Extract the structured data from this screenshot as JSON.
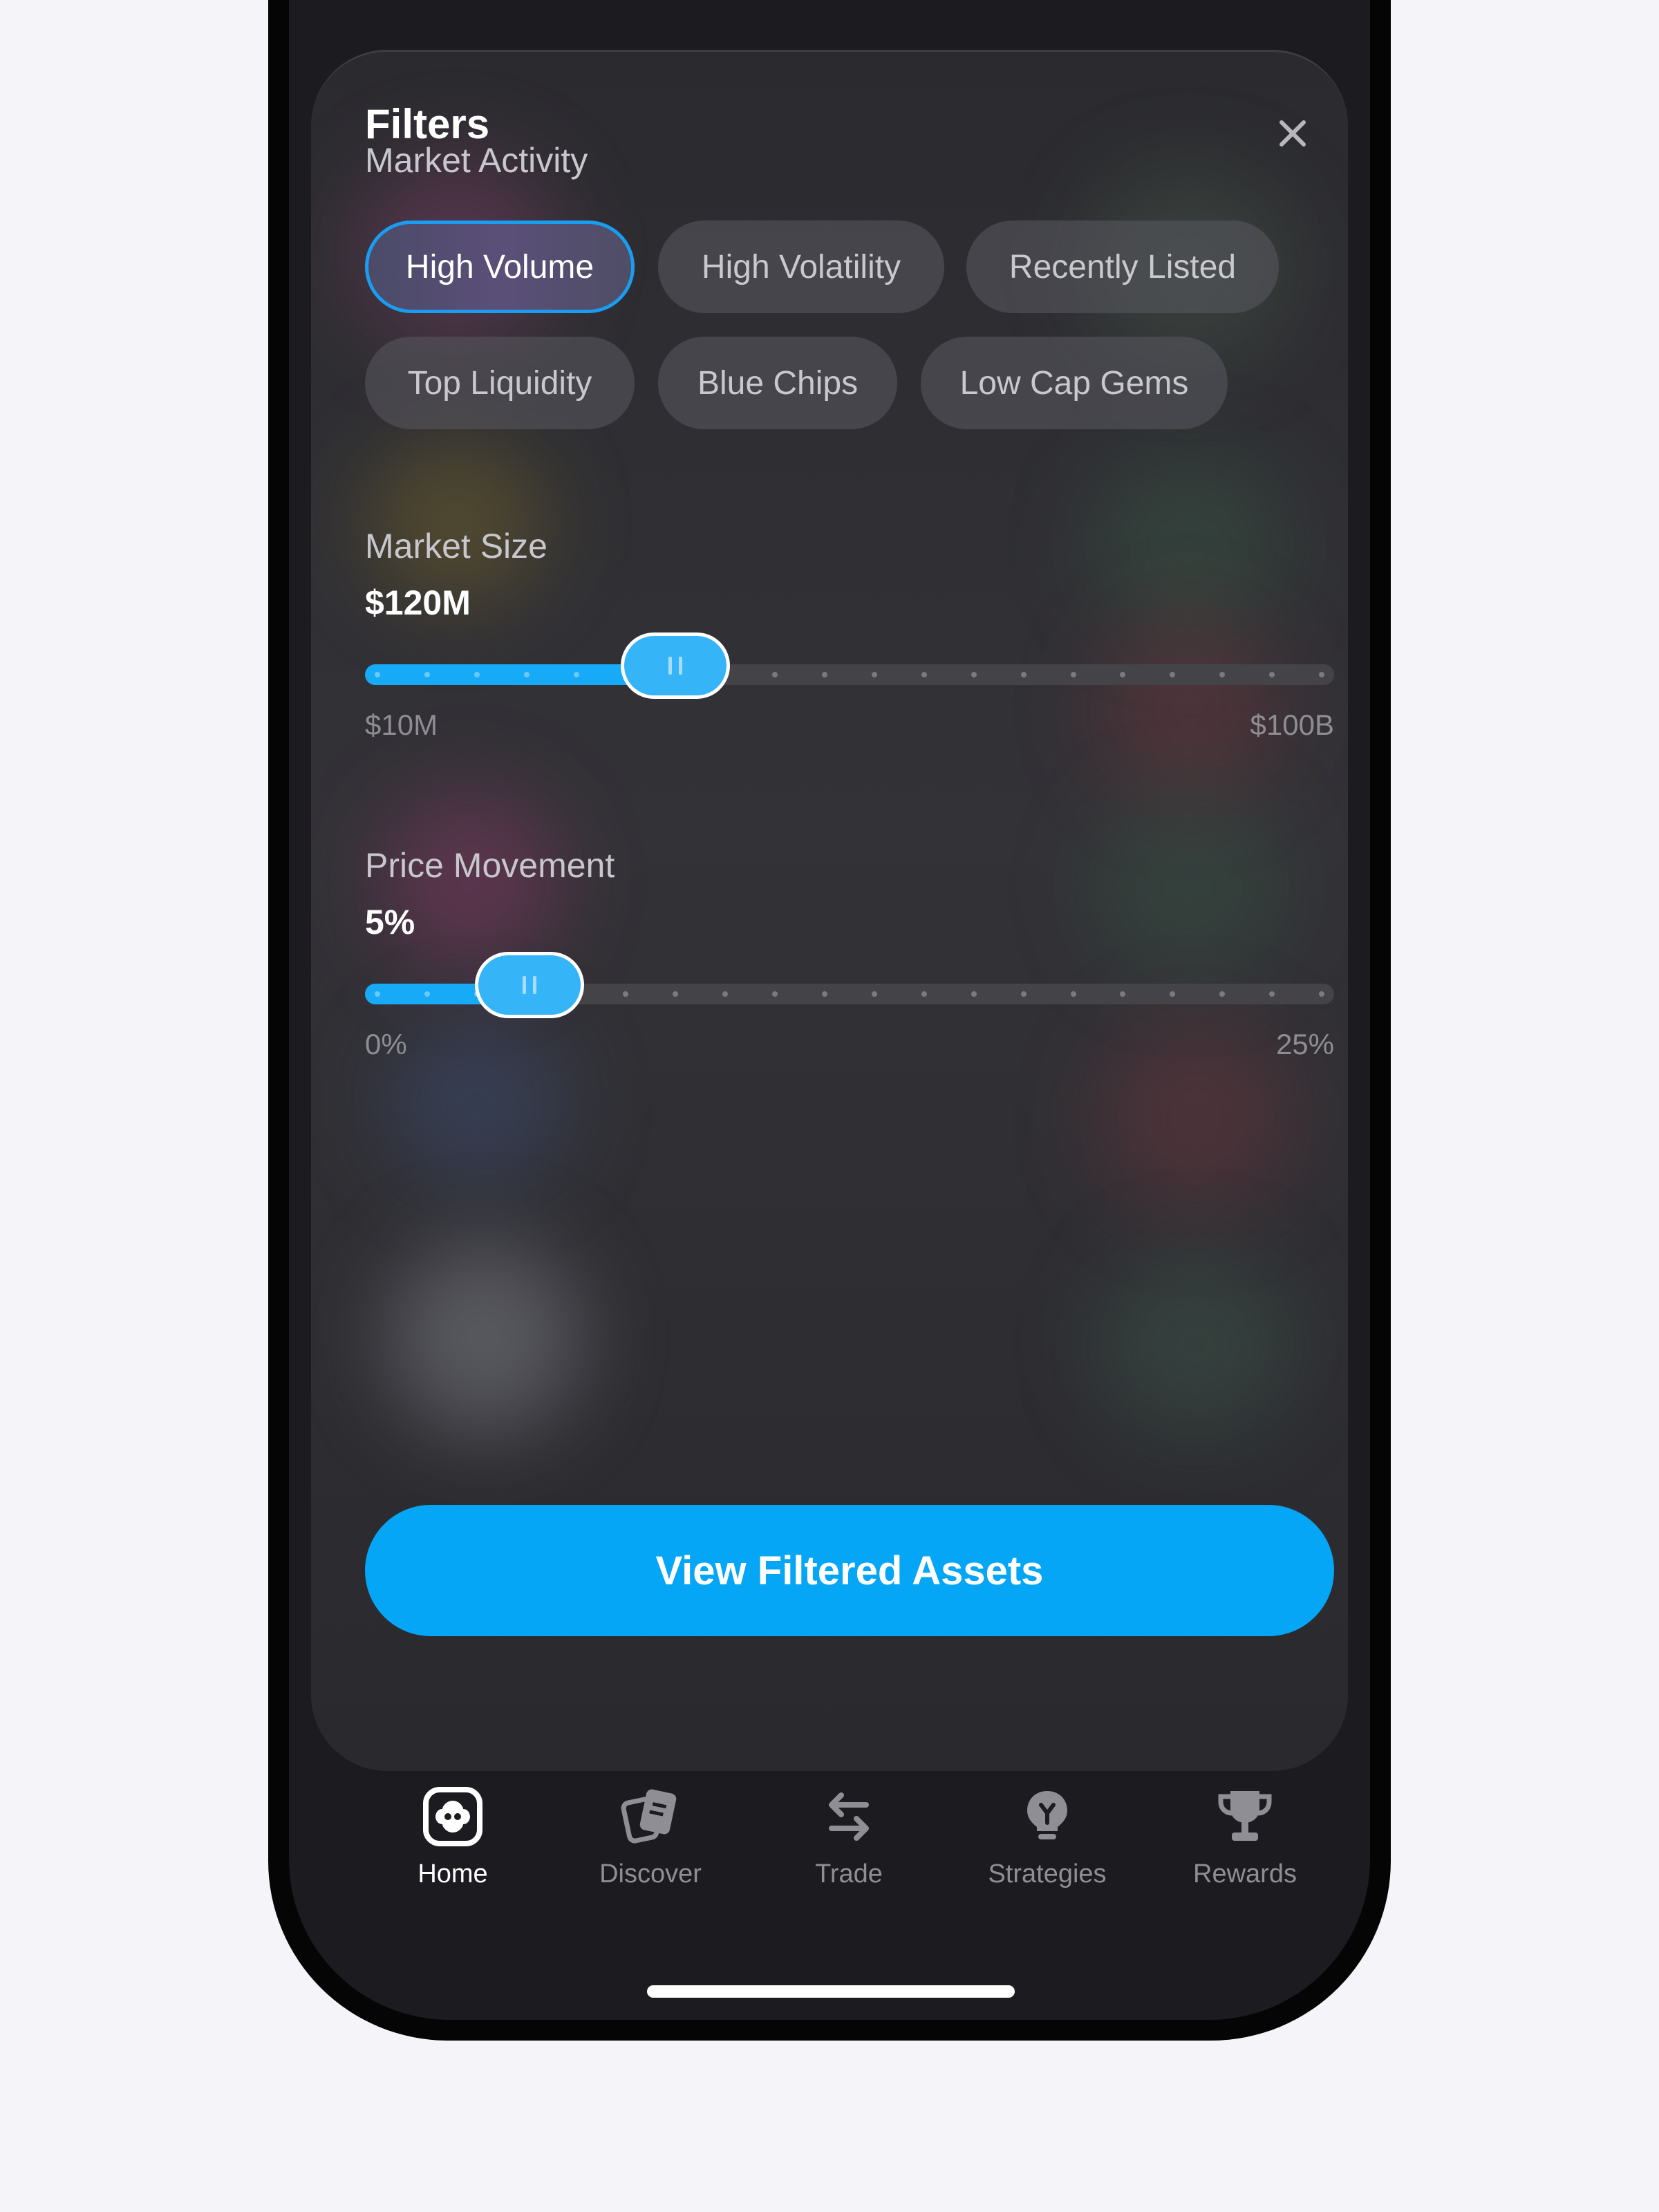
{
  "filters": {
    "title": "Filters",
    "close_icon": "close-icon",
    "market_activity": {
      "label": "Market Activity",
      "chips": [
        {
          "label": "High Volume",
          "selected": true
        },
        {
          "label": "High Volatility",
          "selected": false
        },
        {
          "label": "Recently Listed",
          "selected": false
        },
        {
          "label": "Top Liquidity",
          "selected": false
        },
        {
          "label": "Blue Chips",
          "selected": false
        },
        {
          "label": "Low Cap Gems",
          "selected": false
        }
      ]
    },
    "market_size": {
      "label": "Market Size",
      "value": "$120M",
      "min_label": "$10M",
      "max_label": "$100B",
      "fraction": 0.32
    },
    "price_movement": {
      "label": "Price Movement",
      "value": "5%",
      "min_label": "0%",
      "max_label": "25%",
      "fraction": 0.17
    },
    "cta_label": "View Filtered Assets"
  },
  "tabbar": {
    "items": [
      {
        "label": "Home",
        "icon": "home-icon",
        "active": true
      },
      {
        "label": "Discover",
        "icon": "discover-cards-icon",
        "active": false
      },
      {
        "label": "Trade",
        "icon": "swap-arrows-icon",
        "active": false
      },
      {
        "label": "Strategies",
        "icon": "lightbulb-icon",
        "active": false
      },
      {
        "label": "Rewards",
        "icon": "trophy-icon",
        "active": false
      }
    ]
  },
  "colors": {
    "accent": "#05a6f6",
    "sheet": "#2f2e33",
    "background": "#f5f4f8"
  }
}
